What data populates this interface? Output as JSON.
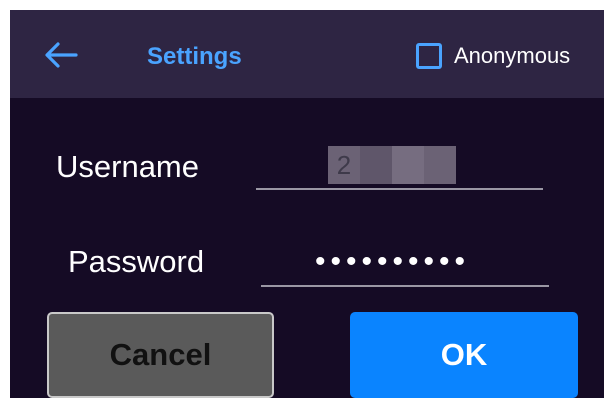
{
  "header": {
    "back_icon": "arrow-left-icon",
    "title": "Settings",
    "anonymous": {
      "label": "Anonymous",
      "checked": false
    }
  },
  "form": {
    "username": {
      "label": "Username",
      "value_chars": [
        "2",
        "",
        "",
        ""
      ]
    },
    "password": {
      "label": "Password",
      "masked_value": "••••••••••"
    }
  },
  "buttons": {
    "cancel_label": "Cancel",
    "ok_label": "OK"
  },
  "colors": {
    "accent": "#4aa3ff",
    "header_bg": "#2e2543",
    "body_bg": "#150b25",
    "ok_bg": "#0a84ff",
    "cancel_bg": "#5a5a5a"
  }
}
